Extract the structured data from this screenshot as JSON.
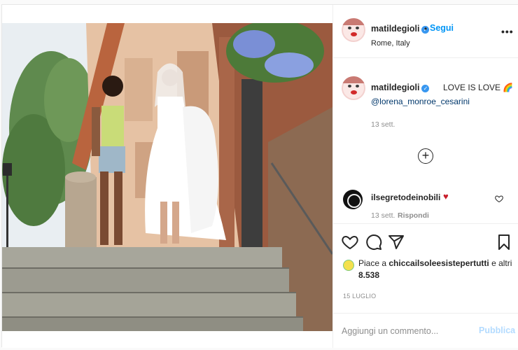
{
  "post": {
    "author": {
      "username": "matildegioli",
      "verified": true,
      "follow_label": "Segui",
      "location": "Rome, Italy"
    },
    "caption": {
      "text": "LOVE IS LOVE 🌈",
      "mention": "@lorena_monroe_cesarini",
      "date": "13 sett."
    },
    "comments": [
      {
        "username": "ilsegretodeinobili",
        "text": "♥",
        "date": "13 sett.",
        "reply_label": "Rispondi"
      }
    ],
    "likes": {
      "prefix": "Piace a ",
      "liker": "chiccailsoleesistepertutti",
      "middle": " e altri ",
      "count": "8.538"
    },
    "post_date": "15 LUGLIO",
    "comment_box": {
      "placeholder": "Aggiungi un commento...",
      "publish_label": "Pubblica"
    }
  },
  "icons": {
    "verified": "verified-badge-icon",
    "more": "more-options-icon",
    "load_more": "plus-circle-icon",
    "like": "heart-icon",
    "comment": "comment-bubble-icon",
    "share": "paper-plane-icon",
    "save": "bookmark-icon"
  },
  "colors": {
    "link_blue": "#0095f6",
    "publish_disabled": "#b3dbff",
    "muted": "#8e8e8e"
  }
}
